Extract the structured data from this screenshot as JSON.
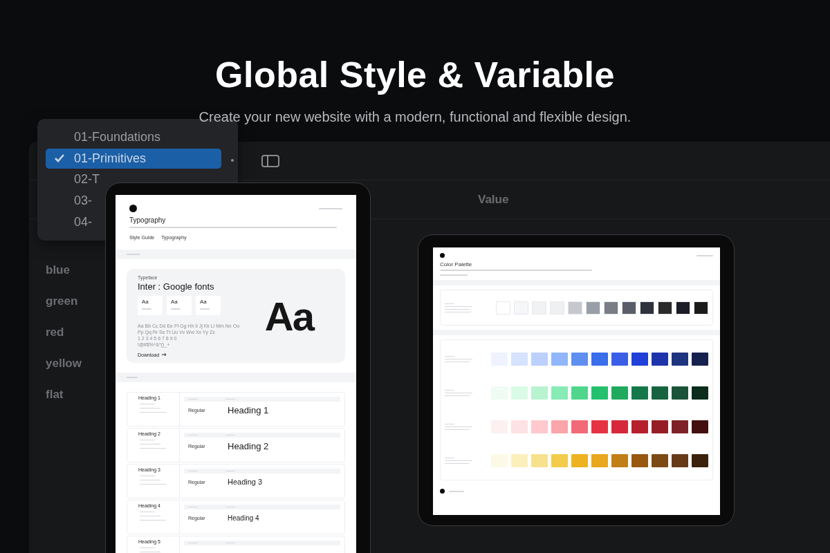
{
  "hero": {
    "title": "Global Style & Variable",
    "subtitle": "Create your new website with a modern, functional and flexible design."
  },
  "app": {
    "column_header": "Value",
    "rows": [
      "blue",
      "green",
      "red",
      "yellow",
      "flat"
    ]
  },
  "menu": [
    {
      "label": "01-Foundations",
      "selected": false
    },
    {
      "label": "01-Primitives",
      "selected": true
    },
    {
      "label": "02-T",
      "selected": false
    },
    {
      "label": "03-",
      "selected": false
    },
    {
      "label": "04-",
      "selected": false
    }
  ],
  "typography_page": {
    "title": "Typography",
    "breadcrumb": [
      "Style Guide",
      "Typography"
    ],
    "typeface_label": "Typeface",
    "typeface": "Inter : Google fonts",
    "weights": [
      "Aa",
      "Aa",
      "Aa"
    ],
    "characters": [
      "Aa Bb Cc Dd Ee Ff Gg Hh Ii Jj Kk Ll Mm Nn Oo",
      "Pp Qq Rr Ss Tt Uu Vv Ww Xx Yy Zz",
      "1 2 3 4 5 6 7 8 9 0",
      "!@#$%^&*()_+"
    ],
    "download": "Download",
    "specimen": "Aa",
    "headings": [
      {
        "label": "Heading 1",
        "weight": "Regular",
        "sample": "Heading 1"
      },
      {
        "label": "Heading 2",
        "weight": "Regular",
        "sample": "Heading 2"
      },
      {
        "label": "Heading 3",
        "weight": "Regular",
        "sample": "Heading 3"
      },
      {
        "label": "Heading 4",
        "weight": "Regular",
        "sample": "Heading 4"
      },
      {
        "label": "Heading 5"
      }
    ]
  },
  "color_page": {
    "title": "Color Palette",
    "neutral": [
      {
        "color": "#ffffff"
      },
      {
        "color": "#f6f7f9"
      },
      {
        "color": "#f0f2f4"
      },
      {
        "color": "#eef0f2"
      },
      {
        "color": "#c6c8ce"
      },
      {
        "color": "#9a9ea8"
      },
      {
        "color": "#7a7c86"
      },
      {
        "color": "#5a5e68"
      },
      {
        "color": "#2e323d"
      },
      {
        "color": "#2a2a2a"
      },
      {
        "color": "#1c1d27"
      },
      {
        "color": "#1b1b1b"
      }
    ],
    "palettes": [
      {
        "swatches": [
          {
            "color": "#eef3ff"
          },
          {
            "color": "#d6e2fe"
          },
          {
            "color": "#bcd0fd"
          },
          {
            "color": "#92b6fb"
          },
          {
            "color": "#5f8ff0"
          },
          {
            "color": "#3a6eea"
          },
          {
            "color": "#3a5fe6"
          },
          {
            "color": "#2140d8"
          },
          {
            "color": "#1d34ab"
          },
          {
            "color": "#1f347f"
          },
          {
            "color": "#172150"
          }
        ]
      },
      {
        "swatches": [
          {
            "color": "#effbf3"
          },
          {
            "color": "#d9fbe6"
          },
          {
            "color": "#b7f3cf"
          },
          {
            "color": "#86ebb4"
          },
          {
            "color": "#4fd68c"
          },
          {
            "color": "#25c06d"
          },
          {
            "color": "#1faa5e"
          },
          {
            "color": "#15784a"
          },
          {
            "color": "#176340"
          },
          {
            "color": "#1a5339"
          },
          {
            "color": "#0c2c1c"
          }
        ]
      },
      {
        "swatches": [
          {
            "color": "#fdf0f0"
          },
          {
            "color": "#fde2e3"
          },
          {
            "color": "#fdc9cc"
          },
          {
            "color": "#faa5aa"
          },
          {
            "color": "#f26a77"
          },
          {
            "color": "#e53343"
          },
          {
            "color": "#d6283a"
          },
          {
            "color": "#b61f2c"
          },
          {
            "color": "#951d25"
          },
          {
            "color": "#7e2227"
          },
          {
            "color": "#44100f"
          }
        ]
      },
      {
        "swatches": [
          {
            "color": "#fcf9e6"
          },
          {
            "color": "#fbf0bb"
          },
          {
            "color": "#f7e18d"
          },
          {
            "color": "#f2cc4a"
          },
          {
            "color": "#ecb220"
          },
          {
            "color": "#e8a71d"
          },
          {
            "color": "#c17f18"
          },
          {
            "color": "#98580f"
          },
          {
            "color": "#7c4a15"
          },
          {
            "color": "#663b18"
          },
          {
            "color": "#3b220c"
          }
        ]
      }
    ]
  }
}
